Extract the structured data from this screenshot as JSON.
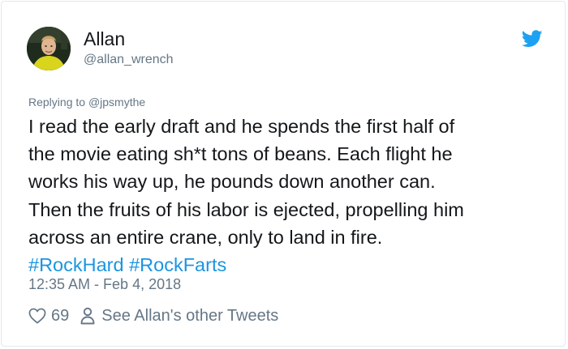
{
  "user": {
    "display_name": "Allan",
    "handle": "@allan_wrench"
  },
  "reply": {
    "prefix": "Replying to ",
    "mention": "@jpsmythe"
  },
  "tweet": {
    "lines": [
      "I read the early draft and he spends the first half of",
      "the movie eating sh*t tons of beans.  Each flight he",
      "works his way up, he pounds down another can.",
      "Then the fruits of his labor is ejected, propelling him",
      "across an entire crane, only to land in fire."
    ],
    "hashtags": [
      "#RockHard",
      "#RockFarts"
    ],
    "timestamp": "12:35 AM - Feb 4, 2018"
  },
  "actions": {
    "likes": "69",
    "other_tweets_label": "See Allan's other Tweets"
  },
  "icons": {
    "avatar": "avatar",
    "brand": "twitter-bird-icon",
    "like": "heart-icon",
    "profile": "person-icon"
  },
  "colors": {
    "brand_blue": "#1da1f2",
    "hashtag_blue": "#1b95e0",
    "muted_gray": "#657786",
    "text": "#14171a"
  }
}
